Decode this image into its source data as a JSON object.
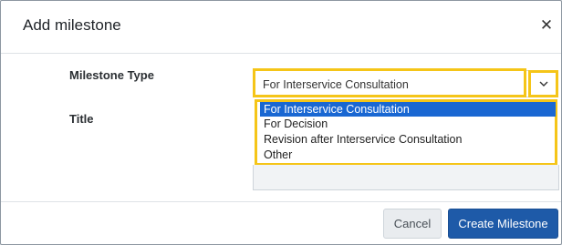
{
  "modal": {
    "title": "Add milestone",
    "close_symbol": "✕"
  },
  "form": {
    "milestone_type_label": "Milestone Type",
    "title_label": "Title",
    "selected_type": "For Interservice Consultation",
    "title_value": ""
  },
  "dropdown": {
    "options": [
      "For Interservice Consultation",
      "For Decision",
      "Revision after Interservice Consultation",
      "Other"
    ],
    "selected_index": 0
  },
  "footer": {
    "cancel_label": "Cancel",
    "create_label": "Create Milestone"
  },
  "colors": {
    "highlight": "#f5c518",
    "selected_option": "#1967d2",
    "primary_button": "#1e5aa8"
  },
  "icons": {
    "close": "close-icon",
    "dropdown": "chevron-down-icon"
  }
}
